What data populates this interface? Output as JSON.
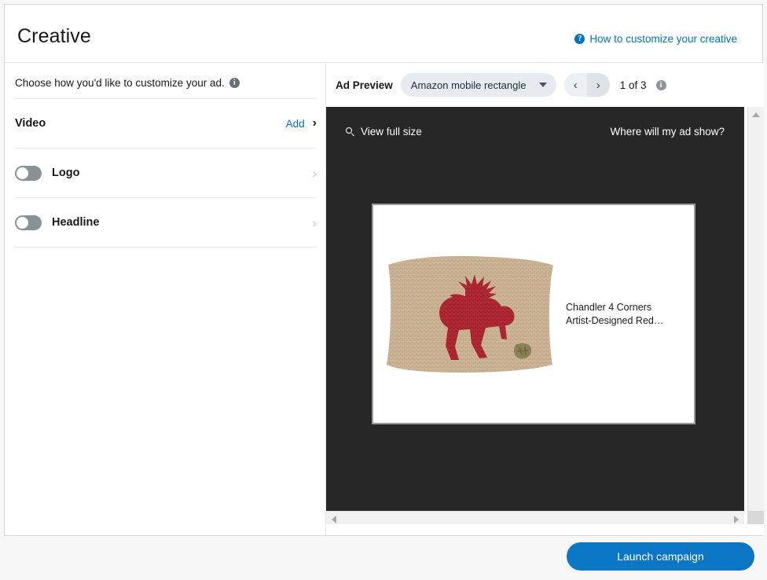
{
  "header": {
    "title": "Creative",
    "help_link": "How to customize your creative",
    "help_icon": "question-circle-icon"
  },
  "left_panel": {
    "intro": "Choose how you'd like to customize your ad.",
    "intro_icon": "info-circle-icon",
    "options": [
      {
        "label": "Video",
        "action": "Add",
        "has_toggle": false,
        "chevron": "chevron-right-icon"
      },
      {
        "label": "Logo",
        "action": "",
        "has_toggle": true,
        "toggle_state": "off",
        "chevron": "chevron-right-icon"
      },
      {
        "label": "Headline",
        "action": "",
        "has_toggle": true,
        "toggle_state": "off",
        "chevron": "chevron-right-icon"
      }
    ]
  },
  "preview": {
    "label": "Ad Preview",
    "format_selected": "Amazon mobile rectangle",
    "caret_icon": "chevron-down-icon",
    "prev_icon": "chevron-left-icon",
    "next_icon": "chevron-right-icon",
    "pagination": "1 of 3",
    "pagination_icon": "info-circle-icon",
    "view_full_size": "View full size",
    "view_full_size_icon": "search-icon",
    "where_will_ad_show": "Where will my ad show?",
    "ad": {
      "product_title_line1": "Chandler 4 Corners",
      "product_title_line2": "Artist-Designed Red…",
      "image_alt": "hooked-wool-pillow-with-red-moose"
    }
  },
  "footer": {
    "launch_label": "Launch campaign"
  },
  "colors": {
    "accent_blue": "#0073bb",
    "button_blue": "#0a76c4",
    "stage_dark": "#272727",
    "toggle_track": "#879196"
  }
}
